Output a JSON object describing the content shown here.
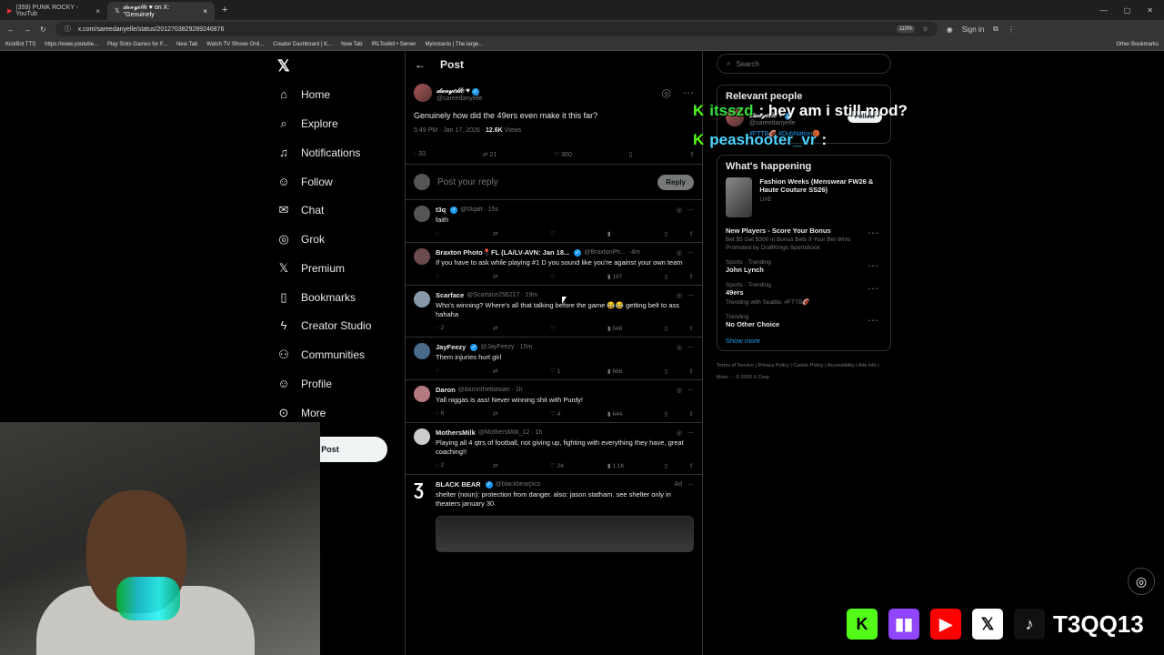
{
  "browser": {
    "tabs": [
      {
        "label": "(359) PUNK ROCKY - YouTub"
      },
      {
        "label": "𝒹𝒶𝓃𝓎𝑒𝓁𝓁𝑒 ♥ on X: \"Genuinely"
      }
    ],
    "url": "x.com/sareedanyelle/status/2012703829289246876",
    "zoom": "110%",
    "bookmarks": [
      "KickBot TTS",
      "https://www.youtube...",
      "Play Slots Games for F...",
      "New Tab",
      "Watch TV Shows Onli...",
      "Creator Dashboard | K...",
      "New Tab",
      "IRLToolkit • Server",
      "Myinstants | The large..."
    ],
    "other_bookmarks": "Other Bookmarks",
    "sign_in": "Sign in"
  },
  "nav": {
    "items": [
      {
        "label": "Home",
        "icon": "home-icon",
        "glyph": "⌂"
      },
      {
        "label": "Explore",
        "icon": "search-icon",
        "glyph": "⌕"
      },
      {
        "label": "Notifications",
        "icon": "bell-icon",
        "glyph": "🔔"
      },
      {
        "label": "Follow",
        "icon": "follow-icon",
        "glyph": "👤"
      },
      {
        "label": "Chat",
        "icon": "mail-icon",
        "glyph": "✉"
      },
      {
        "label": "Grok",
        "icon": "grok-icon",
        "glyph": "◎"
      },
      {
        "label": "Premium",
        "icon": "x-icon",
        "glyph": "X"
      },
      {
        "label": "Bookmarks",
        "icon": "bookmark-icon",
        "glyph": "🔖"
      },
      {
        "label": "Creator Studio",
        "icon": "lightning-icon",
        "glyph": "ϟ"
      },
      {
        "label": "Communities",
        "icon": "people-icon",
        "glyph": "👥"
      },
      {
        "label": "Profile",
        "icon": "profile-icon",
        "glyph": "👤"
      },
      {
        "label": "More",
        "icon": "more-icon",
        "glyph": "⋯"
      }
    ],
    "post_button": "Post"
  },
  "main": {
    "header": "Post",
    "op": {
      "name": "𝒹𝒶𝓃𝓎𝑒𝓁𝓁𝑒 ♥",
      "handle": "@sareedanyelle",
      "text": "Genuinely how did the 49ers even make it this far?",
      "time": "5:49 PM · Jan 17, 2026 ·",
      "views": "12.6K",
      "views_label": "Views",
      "replies": "33",
      "reposts": "21",
      "likes": "300"
    },
    "reply_placeholder": "Post your reply",
    "reply_button": "Reply",
    "replies": [
      {
        "name": "t3q",
        "meta": "@t3qalt · 15s",
        "text": "faith",
        "replies": "",
        "reposts": "",
        "likes": "",
        "views": ""
      },
      {
        "name": "Braxton Photo📍FL (LA/LV-AVN: Jan 18...",
        "meta": "@BraxtonPh... · 4m",
        "text": "If you have to ask while playing #1 D you sound like you're against your own team",
        "replies": "",
        "reposts": "",
        "likes": "",
        "views": "197"
      },
      {
        "name": "Scarface",
        "meta": "@Scarface256217 · 19m",
        "text": "Who's winning? Where's all that talking before the game 😂😂 getting belt to ass hahaha",
        "replies": "2",
        "reposts": "",
        "likes": "",
        "views": "548"
      },
      {
        "name": "JayFeezy",
        "meta": "@JayFeezy · 15m",
        "text": "Them injuries hurt girl",
        "replies": "",
        "reposts": "",
        "likes": "1",
        "views": "666"
      },
      {
        "name": "Daron",
        "meta": "@darontheblasian · 1h",
        "text": "Yall niggas is ass! Never winning shit with Purdy!",
        "replies": "6",
        "reposts": "",
        "likes": "4",
        "views": "644"
      },
      {
        "name": "MothersMilk",
        "meta": "@MothersMilk_12 · 1h",
        "text": "Playing all 4 qtrs of football, not giving up, fighting with everything they have, great coaching!!",
        "replies": "2",
        "reposts": "",
        "likes": "24",
        "views": "1.1K"
      },
      {
        "name": "BLACK BEAR",
        "meta": "@blackbearpics",
        "ad": "Ad",
        "text": "shelter (noun): protection from danger. also: jason statham. see shelter only in theaters january 30"
      }
    ]
  },
  "side": {
    "search_placeholder": "Search",
    "relevant_title": "Relevant people",
    "relevant": {
      "name": "𝒹𝒶𝓃𝓎𝑒𝓁𝓁𝑒 ♥",
      "handle": "@sareedanyelle",
      "bio": "#FTTB🏈 #DubNation🏀",
      "follow": "Follow"
    },
    "whats_happening": "What's happening",
    "featured": {
      "title": "Fashion Weeks (Menswear FW26 & Haute Couture SS26)",
      "status": "LIVE"
    },
    "trends": [
      {
        "cat": "",
        "title": "New Players - Score Your Bonus",
        "sub": "Bet $5 Get $300 in Bonus Bets If Your Bet Wins",
        "promo": "Promoted by DraftKings Sportsbook"
      },
      {
        "cat": "Sports · Trending",
        "title": "John Lynch",
        "sub": "",
        "promo": ""
      },
      {
        "cat": "Sports · Trending",
        "title": "49ers",
        "sub": "Trending with Seattle, #FTTB🏈",
        "promo": ""
      },
      {
        "cat": "Trending",
        "title": "No Other Choice",
        "sub": "",
        "promo": ""
      }
    ],
    "show_more": "Show more",
    "footer": "Terms of Service | Privacy Policy | Cookie Policy | Accessibility | Ads info | More ··· © 2026 X Corp."
  },
  "overlay": {
    "chat": [
      {
        "user": "itsszd",
        "msg": ": hey am i still mod?"
      },
      {
        "user": "peashooter_vr",
        "msg": ":"
      }
    ],
    "streamer_handle": "T3QQ13",
    "socials": [
      "kick-icon",
      "twitch-icon",
      "youtube-icon",
      "x-icon",
      "tiktok-icon"
    ]
  }
}
